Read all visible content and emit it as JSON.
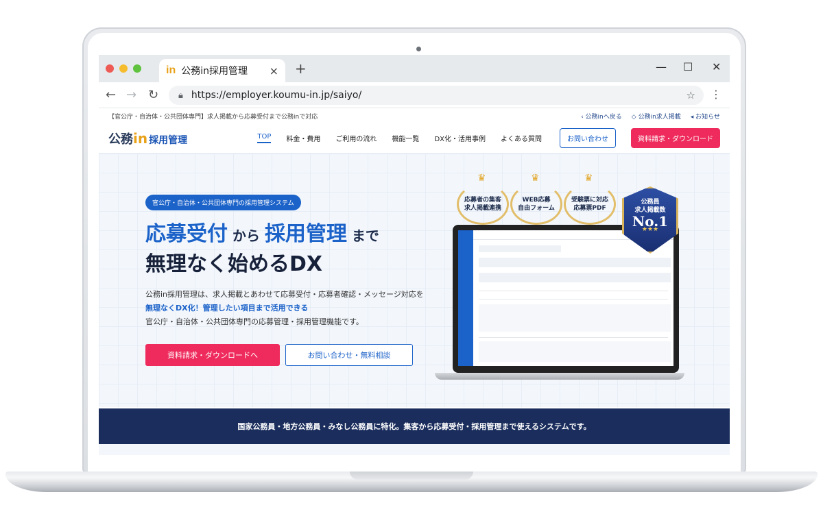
{
  "browser": {
    "tab_title": "公務in採用管理",
    "tab_favicon": "in",
    "tab_close": "×",
    "new_tab": "+",
    "url": "https://employer.koumu-in.jp/saiyo/",
    "window_controls": [
      "—",
      "☐",
      "✕"
    ],
    "nav_icons": [
      "back-arrow-icon",
      "forward-arrow-icon",
      "reload-icon"
    ]
  },
  "site": {
    "topline_text": "【官公庁・自治体・公共団体専門】求人掲載から応募受付まで公務inで対応",
    "topline_links": [
      "公務inへ戻る",
      "公務in求人掲載",
      "お知らせ"
    ],
    "logo_main": "公務",
    "logo_in": "in",
    "logo_sub": "採用管理",
    "nav": [
      "TOP",
      "料金・費用",
      "ご利用の流れ",
      "機能一覧",
      "DX化・活用事例",
      "よくある質問"
    ],
    "contact_button": "お問い合わせ",
    "request_button": "資料請求・ダウンロード"
  },
  "hero": {
    "pill": "官公庁・自治体・公共団体専門の採用管理システム",
    "h1_a": "応募受付",
    "h1_b": " から ",
    "h1_c": "採用管理",
    "h1_d": " まで",
    "h2": "無理なく始めるDX",
    "desc1": "公務in採用管理は、求人掲載とあわせて応募受付・応募者確認・メッセージ対応を",
    "desc2": "無理なくDX化！管理したい項目まで活用できる",
    "desc3": "官公庁・自治体・公共団体専門の応募管理・採用管理機能です。",
    "cta_red": "資料請求・ダウンロードへ",
    "cta_outline": "お問い合わせ・無料相談",
    "badges": [
      {
        "l1": "応募者の集客",
        "l2": "求人掲載連携"
      },
      {
        "l1": "WEB応募",
        "l2": "自由フォーム"
      },
      {
        "l1": "受験票に対応",
        "l2": "応募票PDF"
      }
    ],
    "no1": {
      "l1": "公務員",
      "l2": "求人掲載数",
      "big": "No.1",
      "stars": "★★★"
    }
  },
  "banner": "国家公務員・地方公務員・みなし公務員に特化。集客から応募受付・採用管理まで使えるシステムです。"
}
